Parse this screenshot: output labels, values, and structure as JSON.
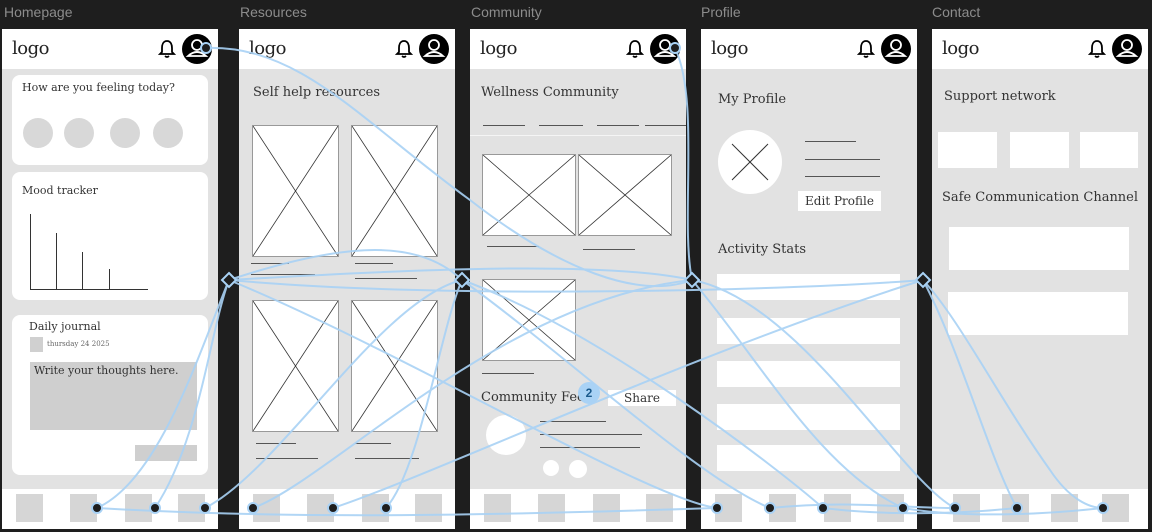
{
  "frames": {
    "homepage": {
      "label": "Homepage",
      "logo": "logo",
      "feeling_title": "How are you feeling today?",
      "mood_title": "Mood tracker",
      "journal_title": "Daily journal",
      "journal_date": "thursday 24 2025",
      "journal_placeholder": "Write your thoughts here."
    },
    "resources": {
      "label": "Resources",
      "logo": "logo",
      "section_title": "Self help resources"
    },
    "community": {
      "label": "Community",
      "logo": "logo",
      "section_title": "Wellness Community",
      "feed_title": "Community Feed",
      "share_label": "Share"
    },
    "profile": {
      "label": "Profile",
      "logo": "logo",
      "section_title": "My Profile",
      "edit_label": "Edit Profile",
      "stats_title": "Activity Stats"
    },
    "contact": {
      "label": "Contact",
      "logo": "logo",
      "network_title": "Support network",
      "channel_title": "Safe Communication Channel"
    }
  },
  "badge_count": "2",
  "colors": {
    "canvas": "#1e1e1e",
    "frame_bg": "#e2e2e2",
    "connector": "#a9d2f5"
  },
  "icons": [
    "bell-icon",
    "user-avatar-icon",
    "image-placeholder-icon"
  ]
}
